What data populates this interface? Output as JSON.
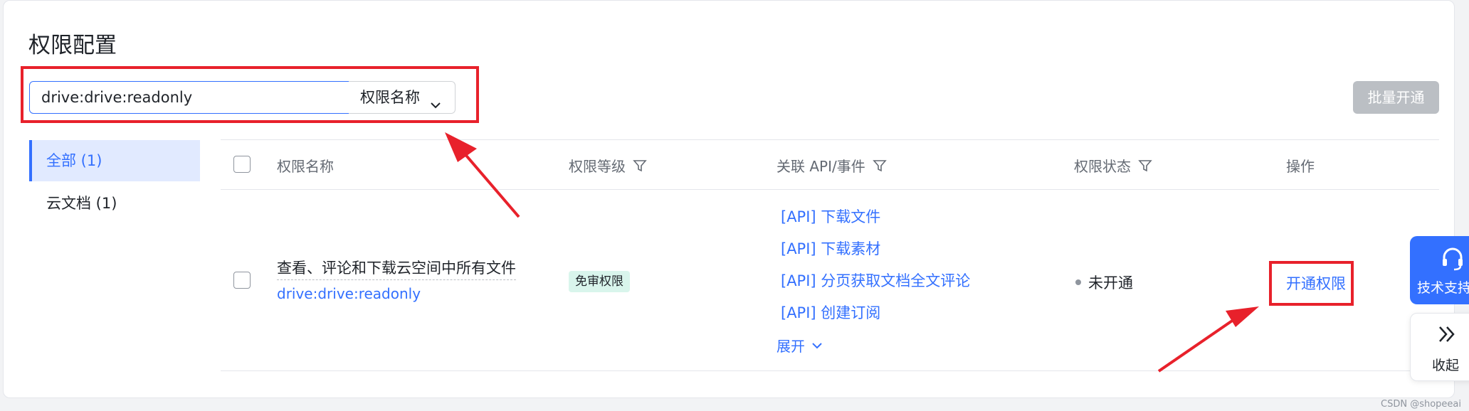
{
  "page": {
    "title": "权限配置"
  },
  "search": {
    "value": "drive:drive:readonly",
    "select_label": "权限名称"
  },
  "toolbar": {
    "batch_label": "批量开通"
  },
  "sidebar": {
    "items": [
      {
        "label": "全部 (1)",
        "active": true
      },
      {
        "label": "云文档 (1)",
        "active": false
      }
    ]
  },
  "table": {
    "headers": [
      "权限名称",
      "权限等级",
      "关联 API/事件",
      "权限状态",
      "操作"
    ],
    "rows": [
      {
        "name": "查看、评论和下载云空间中所有文件",
        "key": "drive:drive:readonly",
        "level": "免审权限",
        "apis": [
          "[API] 下载文件",
          "[API] 下载素材",
          "[API] 分页获取文档全文评论",
          "[API] 创建订阅"
        ],
        "expand_label": "展开",
        "status": "未开通",
        "action": "开通权限"
      }
    ]
  },
  "float": {
    "support_label": "技术支持",
    "collapse_label": "收起"
  },
  "watermark": "CSDN @shopeeai",
  "colors": {
    "accent": "#3370ff",
    "highlight": "#e8212b",
    "badge_bg": "#d9f5ec"
  },
  "icons": [
    "chevron-down-icon",
    "filter-icon",
    "headset-icon",
    "double-chevron-right-icon"
  ]
}
